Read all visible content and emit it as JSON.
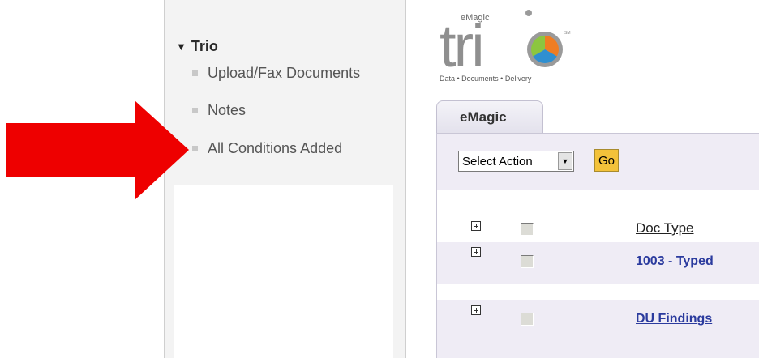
{
  "sidebar": {
    "root_label": "Trio",
    "items": [
      {
        "label": "Upload/Fax Documents"
      },
      {
        "label": "Notes"
      },
      {
        "label": "All Conditions Added"
      }
    ]
  },
  "logo": {
    "brand_small": "eMagic",
    "brand_main": "tri",
    "tagline": "Data • Documents • Delivery",
    "tm": "SM"
  },
  "tabs": [
    {
      "label": "eMagic"
    }
  ],
  "toolbar": {
    "select_value": "Select Action",
    "go_label": "Go"
  },
  "table": {
    "header": "Doc Type",
    "rows": [
      {
        "doc_type": "1003 - Typed"
      },
      {
        "doc_type": "DU Findings"
      }
    ]
  },
  "colors": {
    "arrow": "#ee0000",
    "link": "#2b3b9e",
    "go_button": "#f3c23a",
    "content_bg": "#efecf5"
  }
}
